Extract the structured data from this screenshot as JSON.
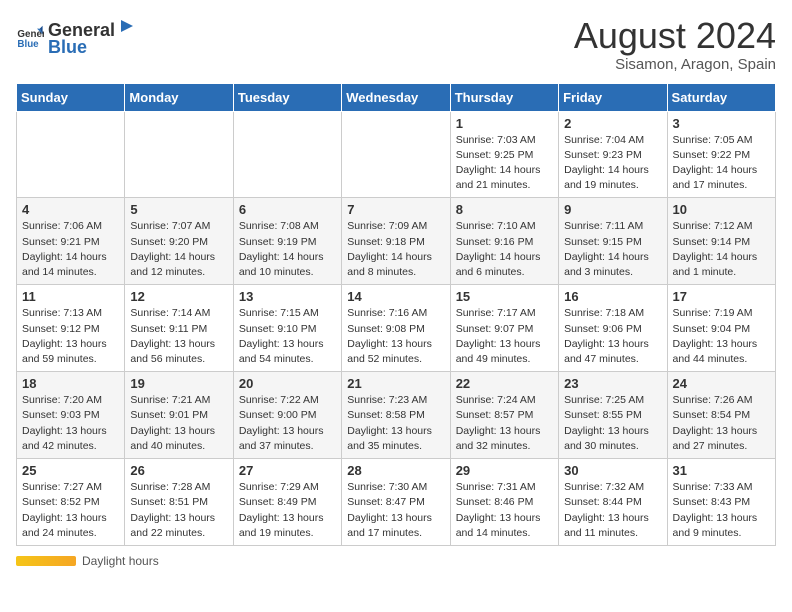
{
  "app": {
    "logo_general": "General",
    "logo_blue": "Blue"
  },
  "header": {
    "title": "August 2024",
    "subtitle": "Sisamon, Aragon, Spain"
  },
  "calendar": {
    "days_of_week": [
      "Sunday",
      "Monday",
      "Tuesday",
      "Wednesday",
      "Thursday",
      "Friday",
      "Saturday"
    ],
    "weeks": [
      [
        {
          "day": "",
          "info": ""
        },
        {
          "day": "",
          "info": ""
        },
        {
          "day": "",
          "info": ""
        },
        {
          "day": "",
          "info": ""
        },
        {
          "day": "1",
          "info": "Sunrise: 7:03 AM\nSunset: 9:25 PM\nDaylight: 14 hours and 21 minutes."
        },
        {
          "day": "2",
          "info": "Sunrise: 7:04 AM\nSunset: 9:23 PM\nDaylight: 14 hours and 19 minutes."
        },
        {
          "day": "3",
          "info": "Sunrise: 7:05 AM\nSunset: 9:22 PM\nDaylight: 14 hours and 17 minutes."
        }
      ],
      [
        {
          "day": "4",
          "info": "Sunrise: 7:06 AM\nSunset: 9:21 PM\nDaylight: 14 hours and 14 minutes."
        },
        {
          "day": "5",
          "info": "Sunrise: 7:07 AM\nSunset: 9:20 PM\nDaylight: 14 hours and 12 minutes."
        },
        {
          "day": "6",
          "info": "Sunrise: 7:08 AM\nSunset: 9:19 PM\nDaylight: 14 hours and 10 minutes."
        },
        {
          "day": "7",
          "info": "Sunrise: 7:09 AM\nSunset: 9:18 PM\nDaylight: 14 hours and 8 minutes."
        },
        {
          "day": "8",
          "info": "Sunrise: 7:10 AM\nSunset: 9:16 PM\nDaylight: 14 hours and 6 minutes."
        },
        {
          "day": "9",
          "info": "Sunrise: 7:11 AM\nSunset: 9:15 PM\nDaylight: 14 hours and 3 minutes."
        },
        {
          "day": "10",
          "info": "Sunrise: 7:12 AM\nSunset: 9:14 PM\nDaylight: 14 hours and 1 minute."
        }
      ],
      [
        {
          "day": "11",
          "info": "Sunrise: 7:13 AM\nSunset: 9:12 PM\nDaylight: 13 hours and 59 minutes."
        },
        {
          "day": "12",
          "info": "Sunrise: 7:14 AM\nSunset: 9:11 PM\nDaylight: 13 hours and 56 minutes."
        },
        {
          "day": "13",
          "info": "Sunrise: 7:15 AM\nSunset: 9:10 PM\nDaylight: 13 hours and 54 minutes."
        },
        {
          "day": "14",
          "info": "Sunrise: 7:16 AM\nSunset: 9:08 PM\nDaylight: 13 hours and 52 minutes."
        },
        {
          "day": "15",
          "info": "Sunrise: 7:17 AM\nSunset: 9:07 PM\nDaylight: 13 hours and 49 minutes."
        },
        {
          "day": "16",
          "info": "Sunrise: 7:18 AM\nSunset: 9:06 PM\nDaylight: 13 hours and 47 minutes."
        },
        {
          "day": "17",
          "info": "Sunrise: 7:19 AM\nSunset: 9:04 PM\nDaylight: 13 hours and 44 minutes."
        }
      ],
      [
        {
          "day": "18",
          "info": "Sunrise: 7:20 AM\nSunset: 9:03 PM\nDaylight: 13 hours and 42 minutes."
        },
        {
          "day": "19",
          "info": "Sunrise: 7:21 AM\nSunset: 9:01 PM\nDaylight: 13 hours and 40 minutes."
        },
        {
          "day": "20",
          "info": "Sunrise: 7:22 AM\nSunset: 9:00 PM\nDaylight: 13 hours and 37 minutes."
        },
        {
          "day": "21",
          "info": "Sunrise: 7:23 AM\nSunset: 8:58 PM\nDaylight: 13 hours and 35 minutes."
        },
        {
          "day": "22",
          "info": "Sunrise: 7:24 AM\nSunset: 8:57 PM\nDaylight: 13 hours and 32 minutes."
        },
        {
          "day": "23",
          "info": "Sunrise: 7:25 AM\nSunset: 8:55 PM\nDaylight: 13 hours and 30 minutes."
        },
        {
          "day": "24",
          "info": "Sunrise: 7:26 AM\nSunset: 8:54 PM\nDaylight: 13 hours and 27 minutes."
        }
      ],
      [
        {
          "day": "25",
          "info": "Sunrise: 7:27 AM\nSunset: 8:52 PM\nDaylight: 13 hours and 24 minutes."
        },
        {
          "day": "26",
          "info": "Sunrise: 7:28 AM\nSunset: 8:51 PM\nDaylight: 13 hours and 22 minutes."
        },
        {
          "day": "27",
          "info": "Sunrise: 7:29 AM\nSunset: 8:49 PM\nDaylight: 13 hours and 19 minutes."
        },
        {
          "day": "28",
          "info": "Sunrise: 7:30 AM\nSunset: 8:47 PM\nDaylight: 13 hours and 17 minutes."
        },
        {
          "day": "29",
          "info": "Sunrise: 7:31 AM\nSunset: 8:46 PM\nDaylight: 13 hours and 14 minutes."
        },
        {
          "day": "30",
          "info": "Sunrise: 7:32 AM\nSunset: 8:44 PM\nDaylight: 13 hours and 11 minutes."
        },
        {
          "day": "31",
          "info": "Sunrise: 7:33 AM\nSunset: 8:43 PM\nDaylight: 13 hours and 9 minutes."
        }
      ]
    ]
  },
  "footer": {
    "daylight_label": "Daylight hours"
  }
}
